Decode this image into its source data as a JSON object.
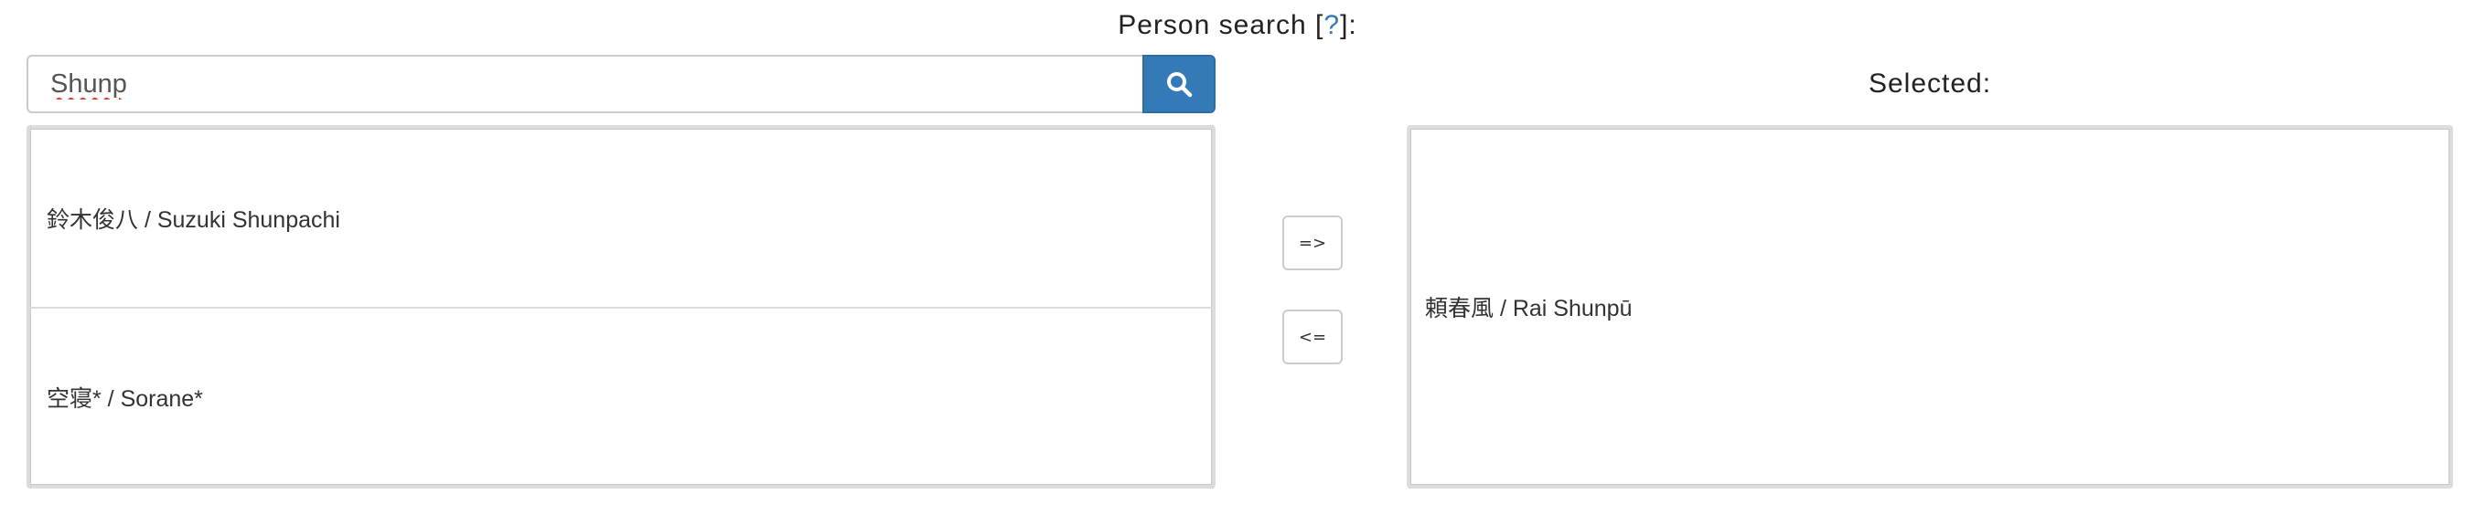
{
  "header": {
    "title": "Person search",
    "help_open": "[",
    "help_link": "?",
    "help_close": "]:"
  },
  "search": {
    "value": "Shunp",
    "button_icon": "search-icon"
  },
  "results": [
    {
      "label": "鈴木俊八 / Suzuki Shunpachi"
    },
    {
      "label": "空寝* / Sorane*"
    }
  ],
  "controls": {
    "add_label": "=>",
    "remove_label": "<="
  },
  "selected": {
    "heading": "Selected:",
    "items": [
      {
        "label": "頼春風 / Rai Shunpū"
      }
    ]
  },
  "colors": {
    "accent": "#337ab7",
    "border": "#cccccc"
  }
}
